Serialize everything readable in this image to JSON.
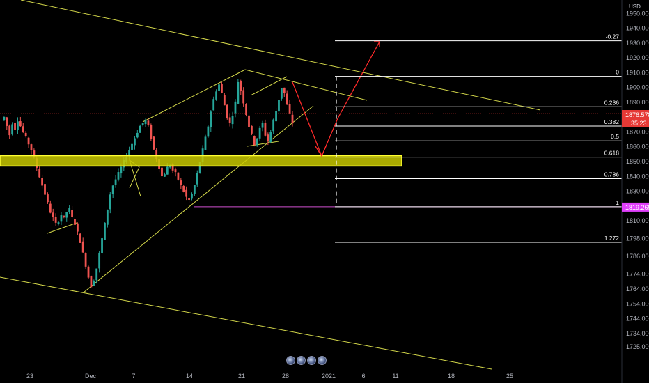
{
  "currency_label": "USD",
  "badges": [
    "event-badge",
    "event-badge",
    "event-badge",
    "event-badge"
  ],
  "colors": {
    "background": "#000000",
    "bull_candle": "#26a69a",
    "bear_candle": "#ef5350",
    "trendline": "#d4d84a",
    "support_zone_fill": "#c8c800",
    "support_zone_border": "#ffff33",
    "projection_arrow": "#ff2a2a",
    "fib_line": "#ffffff",
    "low_marker": "#d050d0",
    "price_tag_red": "#e53935",
    "price_tag_magenta": "#e040fb"
  },
  "chart_data": {
    "type": "candlestick",
    "instrument_unit": "USD",
    "y_axis": {
      "range": [
        1717,
        1952
      ],
      "ticks": [
        "1950.000",
        "1940.000",
        "1930.000",
        "1920.000",
        "1910.000",
        "1900.000",
        "1890.000",
        "1880.000",
        "1870.000",
        "1860.000",
        "1850.000",
        "1840.000",
        "1830.000",
        "1820.000",
        "1810.000",
        "1798.000",
        "1786.000",
        "1774.000",
        "1764.000",
        "1754.000",
        "1744.000",
        "1734.000",
        "1725.000"
      ]
    },
    "x_axis": {
      "ticks": [
        "23",
        "Dec",
        "7",
        "14",
        "21",
        "28",
        "2021",
        "6",
        "11",
        "18",
        "25"
      ]
    },
    "fibonacci": [
      {
        "label": "-0.27",
        "price": 1931.5
      },
      {
        "label": "0",
        "price": 1907.5
      },
      {
        "label": "0.236",
        "price": 1887
      },
      {
        "label": "0.382",
        "price": 1874
      },
      {
        "label": "0.5",
        "price": 1864
      },
      {
        "label": "0.618",
        "price": 1853
      },
      {
        "label": "0.786",
        "price": 1838.5
      },
      {
        "label": "1",
        "price": 1819.5
      },
      {
        "label": "1.272",
        "price": 1795.5
      }
    ],
    "price_tags": [
      {
        "kind": "last_price",
        "value": "1876.578",
        "countdown": "35:23"
      },
      {
        "kind": "low_marker",
        "value": "1819.269"
      }
    ],
    "support_zone": {
      "from": 1847,
      "to": 1854
    },
    "approx_price_path": [
      1878,
      1880,
      1874,
      1868,
      1876,
      1872,
      1878,
      1874,
      1870,
      1866,
      1862,
      1858,
      1852,
      1846,
      1840,
      1834,
      1828,
      1822,
      1816,
      1812,
      1808,
      1810,
      1814,
      1812,
      1816,
      1818,
      1812,
      1808,
      1802,
      1796,
      1788,
      1780,
      1772,
      1766,
      1770,
      1778,
      1788,
      1798,
      1808,
      1818,
      1828,
      1834,
      1838,
      1842,
      1846,
      1850,
      1854,
      1858,
      1862,
      1866,
      1870,
      1874,
      1876,
      1878,
      1874,
      1866,
      1858,
      1852,
      1846,
      1840,
      1842,
      1846,
      1848,
      1844,
      1842,
      1838,
      1834,
      1830,
      1826,
      1824,
      1828,
      1834,
      1842,
      1850,
      1858,
      1866,
      1874,
      1884,
      1892,
      1898,
      1902,
      1896,
      1888,
      1880,
      1876,
      1882,
      1890,
      1904,
      1898,
      1890,
      1882,
      1874,
      1868,
      1862,
      1866,
      1872,
      1876,
      1868,
      1864,
      1870,
      1878,
      1884,
      1892,
      1900,
      1896,
      1888,
      1882,
      1876
    ]
  }
}
